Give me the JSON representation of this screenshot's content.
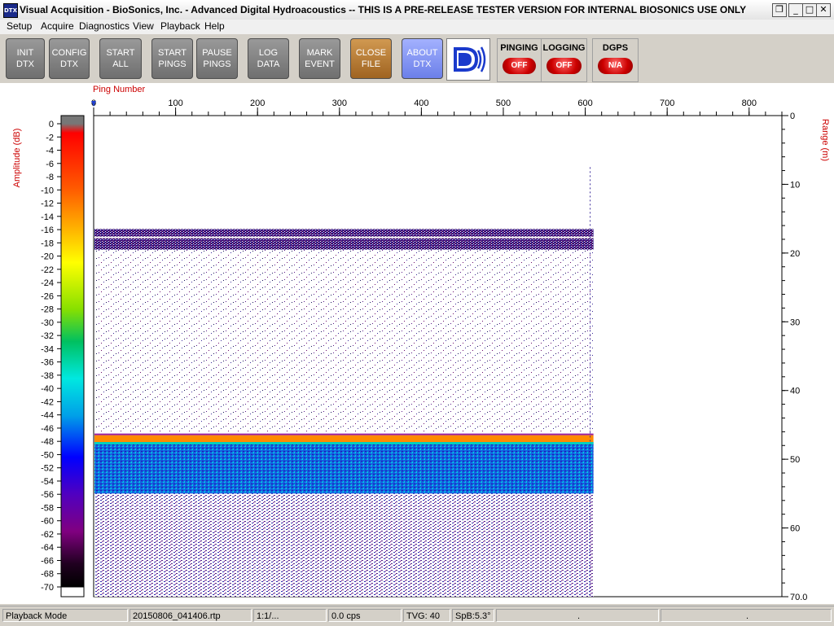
{
  "window": {
    "app_icon": "DTX",
    "title": "Visual Acquisition  -  BioSonics, Inc.  -  Advanced Digital Hydroacoustics  -- THIS IS A PRE-RELEASE TESTER VERSION FOR INTERNAL BIOSONICS USE ONLY",
    "controls": [
      "restore-icon",
      "minimize-icon",
      "maximize-icon",
      "close-icon"
    ]
  },
  "menu": [
    "Setup",
    "Acquire",
    "Diagnostics",
    "View",
    "Playback",
    "Help"
  ],
  "toolbar": [
    {
      "line1": "INIT",
      "line2": "DTX"
    },
    {
      "line1": "CONFIG",
      "line2": "DTX"
    },
    {
      "line1": "START",
      "line2": "ALL"
    },
    {
      "line1": "START",
      "line2": "PINGS"
    },
    {
      "line1": "PAUSE",
      "line2": "PINGS"
    },
    {
      "line1": "LOG",
      "line2": "DATA"
    },
    {
      "line1": "MARK",
      "line2": "EVENT"
    },
    {
      "line1": "CLOSE",
      "line2": "FILE"
    },
    {
      "line1": "ABOUT",
      "line2": "DTX"
    }
  ],
  "logo": "biosonics-logo",
  "indicators": [
    {
      "label": "PINGING",
      "state": "OFF"
    },
    {
      "label": "LOGGING",
      "state": "OFF"
    },
    {
      "label": "DGPS",
      "state": "N/A"
    }
  ],
  "colors": {
    "accent_red": "#cc0000",
    "axis_label": "#cc0000",
    "close_btn": "#b87a36",
    "about_btn": "#8596f5"
  },
  "chart_data": {
    "type": "heatmap",
    "title": "",
    "x_label": "Ping Number",
    "x_ticks": [
      "0",
      "100",
      "200",
      "300",
      "400",
      "500",
      "600",
      "700",
      "800"
    ],
    "x_range": [
      0,
      840
    ],
    "y_label": "Range (m)",
    "y_ticks": [
      "0",
      "10",
      "20",
      "30",
      "40",
      "50",
      "60",
      "70.0"
    ],
    "y_range": [
      0,
      70
    ],
    "colorbar_label": "Amplitude (dB)",
    "colorbar_ticks": [
      "0",
      "-2",
      "-4",
      "-6",
      "-8",
      "-10",
      "-12",
      "-14",
      "-16",
      "-18",
      "-20",
      "-22",
      "-24",
      "-26",
      "-28",
      "-30",
      "-32",
      "-34",
      "-36",
      "-38",
      "-40",
      "-42",
      "-44",
      "-46",
      "-48",
      "-50",
      "-52",
      "-54",
      "-56",
      "-58",
      "-60",
      "-62",
      "-64",
      "-66",
      "-68",
      "-70"
    ],
    "colorbar_range": [
      -70,
      0
    ],
    "pings_recorded": 610,
    "features": [
      {
        "name": "surface band",
        "range_m": [
          16.5,
          19.5
        ],
        "amplitude_db": -56
      },
      {
        "name": "water column scatter",
        "range_m": [
          19.5,
          46
        ],
        "amplitude_db": -66
      },
      {
        "name": "bottom echo",
        "range_m": [
          46.5,
          47.5
        ],
        "amplitude_db": -18
      },
      {
        "name": "bottom layer",
        "range_m": [
          47.5,
          55
        ],
        "amplitude_db": -46
      },
      {
        "name": "sub-bottom scatter",
        "range_m": [
          55,
          70
        ],
        "amplitude_db": -62
      }
    ]
  },
  "statusbar": [
    "Playback Mode",
    "20150806_041406.rtp",
    "1:1/...",
    "0.0 cps",
    "TVG: 40",
    "SpB:5.3°",
    ".",
    "."
  ]
}
